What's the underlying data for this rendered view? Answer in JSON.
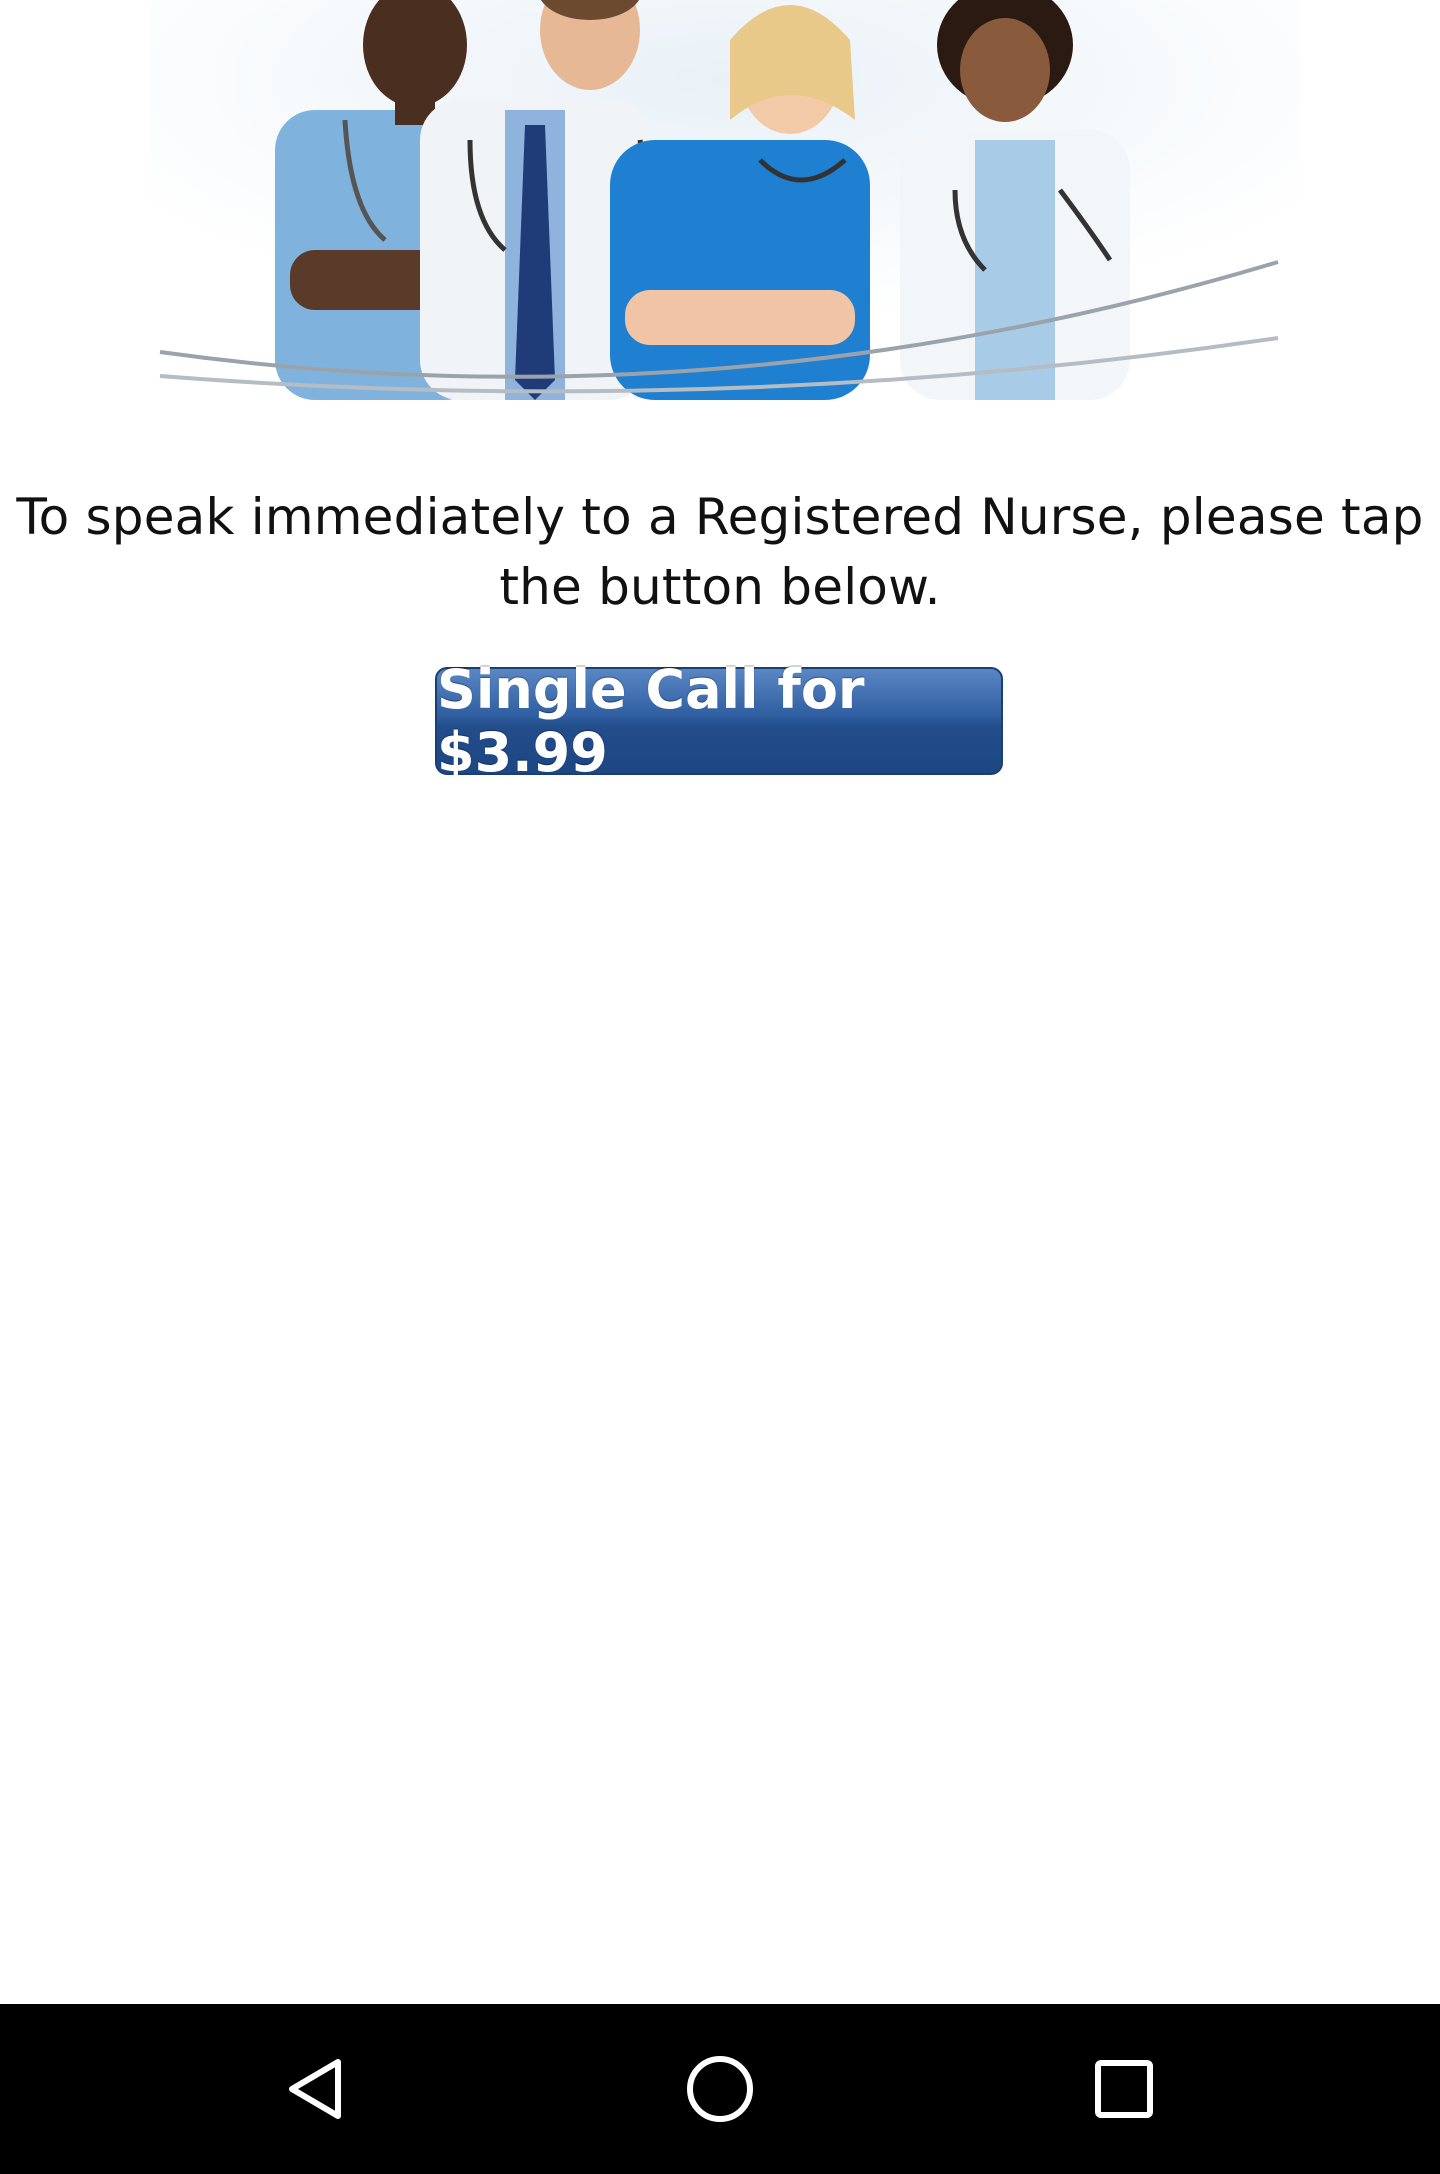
{
  "hero": {
    "icon": "medical-staff-photo"
  },
  "message": {
    "line1": "To speak immediately to a Registered Nurse, please tap",
    "line2": "the button below."
  },
  "cta": {
    "label": "Single Call for $3.99",
    "color": "#2f5fa1"
  },
  "navbar": {
    "back_icon": "back-triangle-icon",
    "home_icon": "home-circle-icon",
    "recents_icon": "recents-square-icon",
    "background": "#000000"
  }
}
